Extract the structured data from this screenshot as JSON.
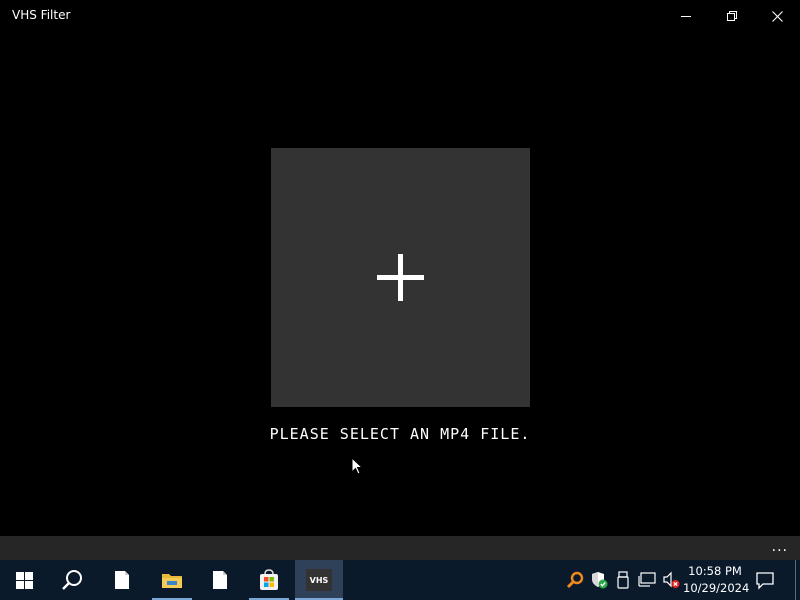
{
  "window": {
    "title": "VHS Filter"
  },
  "main": {
    "prompt": "PLEASE SELECT AN MP4 FILE."
  },
  "appbar": {
    "more_label": "..."
  },
  "taskbar": {
    "active_app_label": "VHS",
    "clock_time": "10:58 PM",
    "clock_date": "10/29/2024"
  },
  "colors": {
    "background": "#000000",
    "drop_zone": "#333333",
    "appbar": "#262626",
    "taskbar": "#0b1a2b"
  },
  "icons": [
    "minimize-icon",
    "maximize-icon",
    "close-icon",
    "plus-icon",
    "cursor-icon",
    "windows-start-icon",
    "search-icon",
    "file-icon",
    "file-explorer-icon",
    "store-icon",
    "search-tool-icon",
    "security-shield-icon",
    "usb-icon",
    "network-icon",
    "volume-muted-icon",
    "notification-icon"
  ]
}
